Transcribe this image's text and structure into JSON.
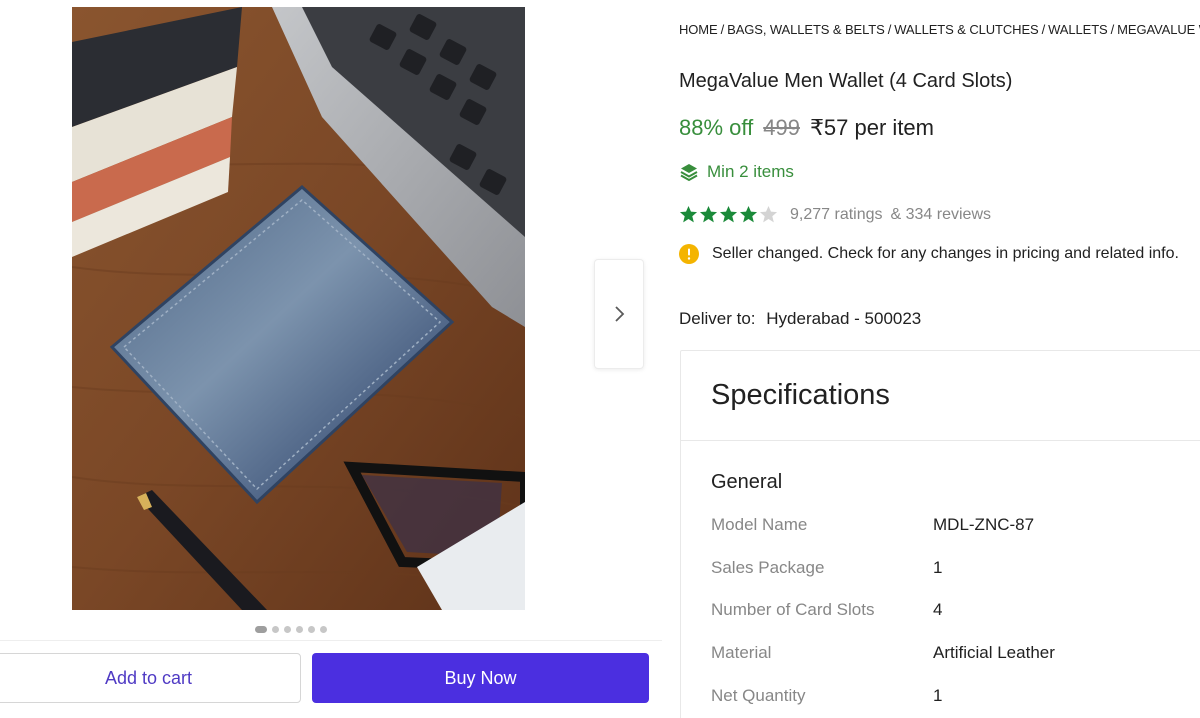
{
  "breadcrumb": [
    "HOME",
    "BAGS, WALLETS & BELTS",
    "WALLETS & CLUTCHES",
    "WALLETS",
    "MEGAVALUE WALLETS"
  ],
  "product": {
    "title": "MegaValue Men Wallet (4 Card Slots)",
    "discount": "88% off",
    "mrp": "499",
    "price": "₹57 per item",
    "min_items": "Min 2 items",
    "rating": 4,
    "ratings_count": "9,277 ratings",
    "reviews_count": "& 334 reviews",
    "seller_notice": "Seller changed. Check for any changes in pricing and related info.",
    "deliver_label": "Deliver to:",
    "deliver_location": "Hyderabad - 500023"
  },
  "gallery": {
    "image_count": 6,
    "active_index": 0,
    "next_icon": "chevron-right-icon"
  },
  "actions": {
    "add_to_cart": "Add to cart",
    "buy_now": "Buy Now"
  },
  "specifications": {
    "heading": "Specifications",
    "section": "General",
    "rows": [
      {
        "key": "Model Name",
        "value": "MDL-ZNC-87"
      },
      {
        "key": "Sales Package",
        "value": "1"
      },
      {
        "key": "Number of Card Slots",
        "value": "4"
      },
      {
        "key": "Material",
        "value": "Artificial Leather"
      },
      {
        "key": "Net Quantity",
        "value": "1"
      }
    ]
  },
  "colors": {
    "discount_green": "#388e3c",
    "primary_purple": "#4b2fe0",
    "star_green": "#1b8a3a",
    "notice_yellow": "#f4b400"
  }
}
